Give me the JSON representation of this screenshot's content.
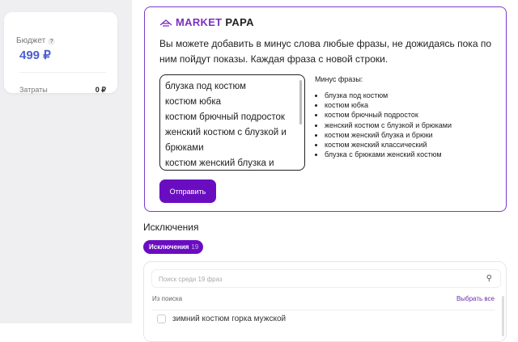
{
  "sidebar": {
    "budget_label": "Бюджет",
    "help": "?",
    "budget_value": "499 ₽",
    "spent_label": "Затраты",
    "spent_value": "0 ₽"
  },
  "logo": {
    "part1": "MARKET",
    "part2": "PAPA"
  },
  "description": "Вы можете добавить в минус слова любые фразы, не дожидаясь пока по ним пойдут показы. Каждая фраза с новой строки.",
  "textarea_value": "блузка под костюм\nкостюм юбка\nкостюм брючный подросток\nженский костюм с блузкой и брюками\nкостюм женский блузка и брюки",
  "minus": {
    "title": "Минус фразы:",
    "items": [
      "блузка под костюм",
      "костюм юбка",
      "костюм брючный подросток",
      "женский костюм с блузкой и брюками",
      "костюм женский блузка и брюки",
      "костюм женский классический",
      "блузка с брюками женский костюм"
    ]
  },
  "send_label": "Отправить",
  "exclusions": {
    "title": "Исключения",
    "tab_label": "Исключения",
    "tab_count": "19",
    "search_placeholder": "Поиск среди 19 фраз",
    "from_search": "Из поиска",
    "select_all": "Выбрать все",
    "rows": [
      "зимний костюм горка мужской"
    ]
  }
}
